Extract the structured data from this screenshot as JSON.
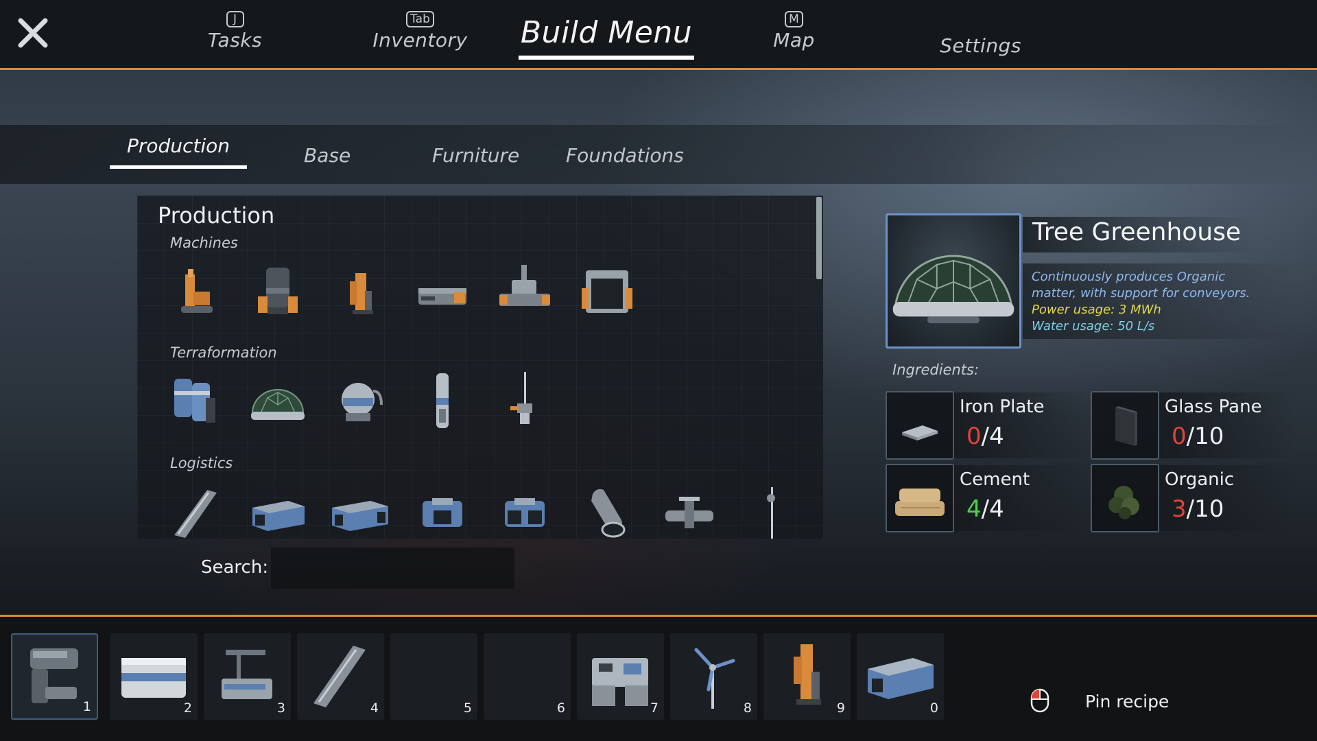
{
  "nav": {
    "tabs": [
      {
        "key": "J",
        "label": "Tasks"
      },
      {
        "key": "Tab",
        "label": "Inventory"
      },
      {
        "key": "",
        "label": "Build Menu"
      },
      {
        "key": "M",
        "label": "Map"
      },
      {
        "key": "",
        "label": "Settings"
      }
    ],
    "active": "Build Menu"
  },
  "subtabs": [
    "Production",
    "Base",
    "Furniture",
    "Foundations"
  ],
  "catalog": {
    "title": "Production",
    "categories": [
      "Machines",
      "Terraformation",
      "Logistics"
    ]
  },
  "search": {
    "label": "Search:",
    "value": ""
  },
  "detail": {
    "title": "Tree Greenhouse",
    "desc_line1": "Continuously produces Organic",
    "desc_line2": "matter, with support for conveyors.",
    "power": "Power usage: 3 MWh",
    "water": "Water usage: 50 L/s",
    "ingredients_label": "Ingredients:",
    "ingredients": [
      {
        "name": "Iron Plate",
        "have": "0",
        "need": "/4",
        "status": "insufficient"
      },
      {
        "name": "Glass Pane",
        "have": "0",
        "need": "/10",
        "status": "insufficient"
      },
      {
        "name": "Cement",
        "have": "4",
        "need": "/4",
        "status": "sufficient"
      },
      {
        "name": "Organic",
        "have": "3",
        "need": "/10",
        "status": "insufficient"
      }
    ]
  },
  "hotbar": {
    "slots": [
      "1",
      "2",
      "3",
      "4",
      "5",
      "6",
      "7",
      "8",
      "9",
      "0"
    ],
    "selected": "1"
  },
  "pin": {
    "label": "Pin recipe"
  },
  "colors": {
    "accent": "#d98a3a",
    "selection": "#6c93c9",
    "insufficient": "#e2443a",
    "sufficient": "#4fd24a",
    "power": "#e4d84a"
  }
}
